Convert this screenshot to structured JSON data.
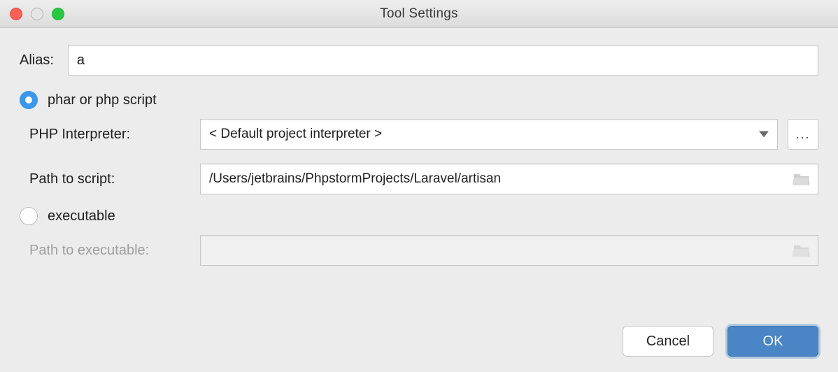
{
  "window": {
    "title": "Tool Settings"
  },
  "form": {
    "alias_label": "Alias:",
    "alias_value": "a",
    "radio_option1_label": "phar or php script",
    "radio_option2_label": "executable",
    "php_interpreter_label": "PHP Interpreter:",
    "php_interpreter_value": "< Default project interpreter >",
    "more_button_label": "...",
    "path_script_label": "Path to script:",
    "path_script_value": "/Users/jetbrains/PhpstormProjects/Laravel/artisan",
    "path_executable_label": "Path to executable:",
    "path_executable_value": ""
  },
  "buttons": {
    "cancel": "Cancel",
    "ok": "OK"
  },
  "selection": {
    "mode": "phar_or_php_script"
  }
}
